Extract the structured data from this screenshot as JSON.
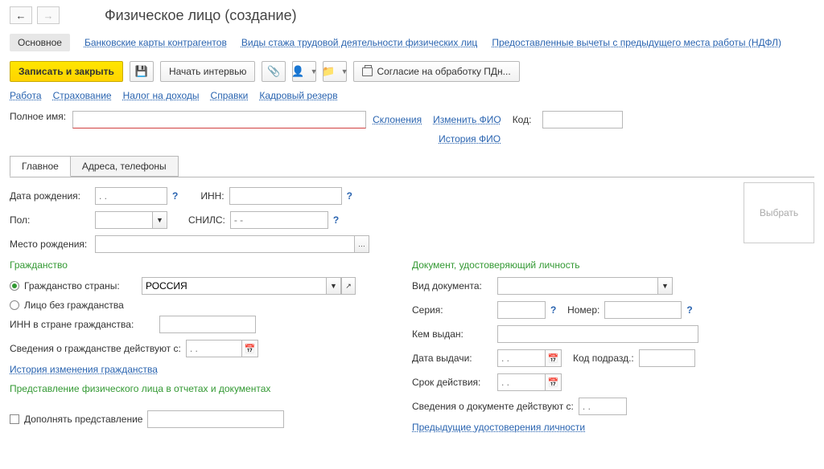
{
  "header": {
    "title": "Физическое лицо (создание)"
  },
  "navTabs": {
    "main": "Основное",
    "cards": "Банковские карты контрагентов",
    "experience": "Виды стажа трудовой деятельности физических лиц",
    "deductions": "Предоставленные вычеты с предыдущего места работы (НДФЛ)"
  },
  "toolbar": {
    "saveClose": "Записать и закрыть",
    "startInterview": "Начать интервью",
    "consent": "Согласие на обработку ПДн..."
  },
  "subLinks": {
    "job": "Работа",
    "insurance": "Страхование",
    "tax": "Налог на доходы",
    "refs": "Справки",
    "reserve": "Кадровый резерв"
  },
  "nameRow": {
    "label": "Полное имя:",
    "value": "",
    "declensions": "Склонения",
    "changeFio": "Изменить ФИО",
    "codeLabel": "Код:",
    "codeValue": "",
    "history": "История ФИО"
  },
  "tabs": {
    "main": "Главное",
    "contacts": "Адреса, телефоны"
  },
  "left": {
    "birthLabel": "Дата рождения:",
    "birthPlaceholder": ". .",
    "innLabel": "ИНН:",
    "innValue": "",
    "genderLabel": "Пол:",
    "genderValue": "",
    "snilsLabel": "СНИЛС:",
    "snilsPlaceholder": "- -",
    "birthPlaceLabel": "Место рождения:",
    "birthPlaceValue": "",
    "citizenshipLegend": "Гражданство",
    "countryLabel": "Гражданство страны:",
    "countryValue": "РОССИЯ",
    "noCountry": "Лицо без гражданства",
    "innCountryLabel": "ИНН в стране гражданства:",
    "innCountryValue": "",
    "citInfoLabel": "Сведения о гражданстве действуют с:",
    "citDate": ". .",
    "citHistory": "История изменения гражданства",
    "reprLegend": "Представление физического лица в отчетах и документах",
    "supplRepr": "Дополнять представление",
    "supplValue": ""
  },
  "right": {
    "docLegend": "Документ, удостоверяющий личность",
    "docTypeLabel": "Вид документа:",
    "docTypeValue": "",
    "seriesLabel": "Серия:",
    "seriesValue": "",
    "numberLabel": "Номер:",
    "numberValue": "",
    "issuedLabel": "Кем выдан:",
    "issuedValue": "",
    "issueDateLabel": "Дата выдачи:",
    "issueDate": ". .",
    "divCodeLabel": "Код подразд.:",
    "divCodeValue": "",
    "validLabel": "Срок действия:",
    "validDate": ". .",
    "docInfoLabel": "Сведения о документе действуют с:",
    "docInfoDate": ". .",
    "prevDocs": "Предыдущие удостоверения личности",
    "selectPhoto": "Выбрать"
  }
}
